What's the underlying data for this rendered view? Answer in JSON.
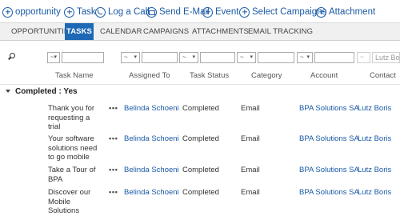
{
  "toolbar": {
    "opportunity": "opportunity",
    "task": "Task",
    "log_call": "Log a Call",
    "send_email": "Send E-Mail",
    "event": "Event",
    "select_campaigns": "Select Campaigns",
    "attachment": "Attachment"
  },
  "tabs": [
    "OPPORTUNITIES",
    "TASKS",
    "CALENDAR",
    "CAMPAIGNS",
    "ATTACHMENTS",
    "EMAIL TRACKING"
  ],
  "active_tab": "TASKS",
  "filters": {
    "operator": "~",
    "caret": "▾",
    "contact_value": "Lutz Boris"
  },
  "columns": {
    "task_name": "Task Name",
    "assigned_to": "Assigned To",
    "task_status": "Task Status",
    "category": "Category",
    "account": "Account",
    "contact": "Contact"
  },
  "group": {
    "label": "Completed : Yes"
  },
  "more_label": "•••",
  "rows": [
    {
      "task_name": "Thank you for requesting a trial",
      "assigned_to": "Belinda Schoeni",
      "status": "Completed",
      "category": "Email",
      "account": "BPA Solutions SA",
      "contact": "Lutz Boris"
    },
    {
      "task_name": "Your software solutions need to go mobile",
      "assigned_to": "Belinda Schoeni",
      "status": "Completed",
      "category": "Email",
      "account": "BPA Solutions SA",
      "contact": "Lutz Boris"
    },
    {
      "task_name": "Take a Tour of BPA",
      "assigned_to": "Belinda Schoeni",
      "status": "Completed",
      "category": "Email",
      "account": "BPA Solutions SA",
      "contact": "Lutz Boris"
    },
    {
      "task_name": "Discover our Mobile Solutions",
      "assigned_to": "Belinda Schoeni",
      "status": "Completed",
      "category": "Email",
      "account": "BPA Solutions SA",
      "contact": "Lutz Boris"
    }
  ]
}
